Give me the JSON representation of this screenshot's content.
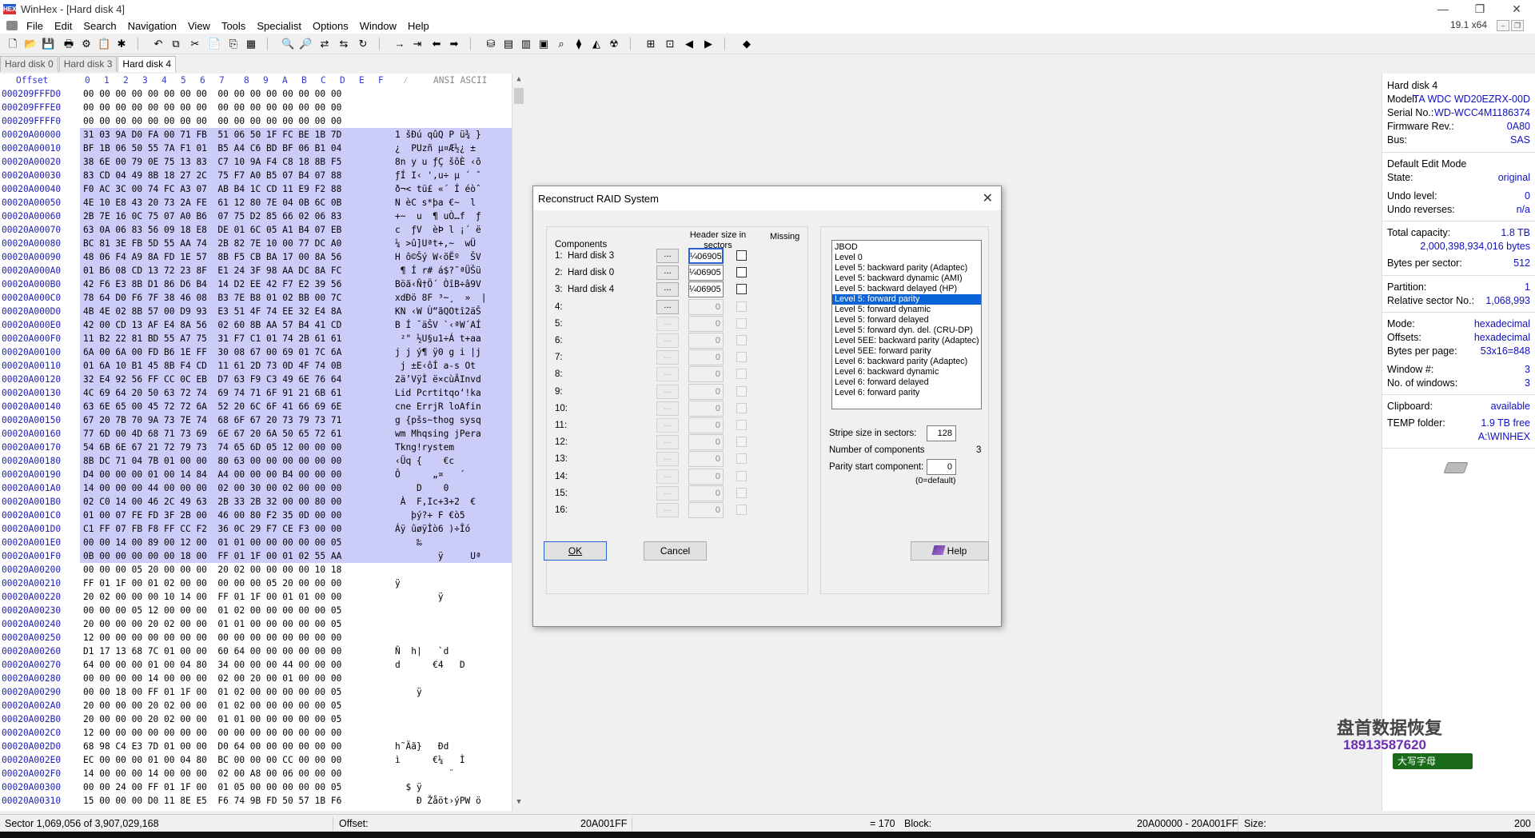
{
  "window": {
    "title": "WinHex - [Hard disk 4]",
    "icon_text": "HEX"
  },
  "menu": {
    "items": [
      "File",
      "Edit",
      "Search",
      "Navigation",
      "View",
      "Tools",
      "Specialist",
      "Options",
      "Window",
      "Help"
    ],
    "version": "19.1 x64"
  },
  "tabs": [
    "Hard disk 0",
    "Hard disk 3",
    "Hard disk 4"
  ],
  "hex": {
    "header_offset": "Offset",
    "header_cols": [
      "0",
      "1",
      "2",
      "3",
      "4",
      "5",
      "6",
      "7",
      "8",
      "9",
      "A",
      "B",
      "C",
      "D",
      "E",
      "F"
    ],
    "header_ascii": "ANSI ASCII",
    "rows": [
      {
        "off": "000209FFFD0",
        "b": "00 00 00 00 00 00 00 00  00 00 00 00 00 00 00 00",
        "a": ""
      },
      {
        "off": "000209FFFE0",
        "b": "00 00 00 00 00 00 00 00  00 00 00 00 00 00 00 00",
        "a": ""
      },
      {
        "off": "000209FFFF0",
        "b": "00 00 00 00 00 00 00 00  00 00 00 00 00 00 00 00",
        "a": ""
      },
      {
        "off": "00020A00000",
        "b": "31 03 9A D0 FA 00 71 FB  51 06 50 1F FC BE 1B 7D",
        "a": "1 šĐú qûQ P ü¾ }"
      },
      {
        "off": "00020A00010",
        "b": "BF 1B 06 50 55 7A F1 01  B5 A4 C6 BD BF 06 B1 04",
        "a": "¿  PUzñ µ¤Æ½¿ ±"
      },
      {
        "off": "00020A00020",
        "b": "38 6E 00 79 0E 75 13 83  C7 10 9A F4 C8 18 8B F5",
        "a": "8n y u ƒÇ šôÈ ‹õ"
      },
      {
        "off": "00020A00030",
        "b": "83 CD 04 49 8B 18 27 2C  75 F7 A0 B5 07 B4 07 88",
        "a": "ƒÍ I‹ ',u÷ µ ´ ˆ"
      },
      {
        "off": "00020A00040",
        "b": "F0 AC 3C 00 74 FC A3 07  AB B4 1C CD 11 E9 F2 88",
        "a": "ð¬< tü£ «´ Í éòˆ"
      },
      {
        "off": "00020A00050",
        "b": "4E 10 E8 43 20 73 2A FE  61 12 80 7E 04 0B 6C 0B",
        "a": "N èC s*þa €~  l"
      },
      {
        "off": "00020A00060",
        "b": "2B 7E 16 0C 75 07 A0 B6  07 75 D2 85 66 02 06 83",
        "a": "+~  u  ¶ uÒ…f  ƒ"
      },
      {
        "off": "00020A00070",
        "b": "63 0A 06 83 56 09 18 E8  DE 01 6C 05 A1 B4 07 EB",
        "a": "c  ƒV  èÞ l ¡´ ë"
      },
      {
        "off": "00020A00080",
        "b": "BC 81 3E FB 5D 55 AA 74  2B 82 7E 10 00 77 DC A0",
        "a": "¼ >û]Uªt+‚~  wÜ "
      },
      {
        "off": "00020A00090",
        "b": "48 06 F4 A9 8A FD 1E 57  8B F5 CB BA 17 00 8A 56",
        "a": "H ô©Šý W‹õËº  ŠV"
      },
      {
        "off": "00020A000A0",
        "b": "01 B6 08 CD 13 72 23 8F  E1 24 3F 98 AA DC 8A FC",
        "a": " ¶ Í r# á$?˜ªÜŠü"
      },
      {
        "off": "00020A000B0",
        "b": "42 F6 E3 8B D1 86 D6 B4  14 D2 EE 42 F7 E2 39 56",
        "a": "Böã‹Ñ†Ö´ ÒîB÷â9V"
      },
      {
        "off": "00020A000C0",
        "b": "78 64 D0 F6 7F 38 46 08  B3 7E B8 01 02 BB 00 7C",
        "a": "xdÐö 8F ³~¸  »  |"
      },
      {
        "off": "00020A000D0",
        "b": "4B 4E 02 8B 57 00 D9 93  E3 51 4F 74 EE 32 E4 8A",
        "a": "KN ‹W Ù“ãQOtî2äŠ"
      },
      {
        "off": "00020A000E0",
        "b": "42 00 CD 13 AF E4 8A 56  02 60 8B AA 57 B4 41 CD",
        "a": "B Í ¯äŠV `‹ªW´AÍ"
      },
      {
        "off": "00020A000F0",
        "b": "11 B2 22 81 BD 55 A7 75  31 F7 C1 01 74 2B 61 61",
        "a": " ²\" ½U§u1÷Á t+aa"
      },
      {
        "off": "00020A00100",
        "b": "6A 00 6A 00 FD B6 1E FF  30 08 67 00 69 01 7C 6A",
        "a": "j j ý¶ ÿ0 g i |j"
      },
      {
        "off": "00020A00110",
        "b": "01 6A 10 B1 45 8B F4 CD  11 61 2D 73 0D 4F 74 0B",
        "a": " j ±E‹ôÍ a-s Ot"
      },
      {
        "off": "00020A00120",
        "b": "32 E4 92 56 FF CC 0C EB  D7 63 F9 C3 49 6E 76 64",
        "a": "2ä’VÿÌ ë×cùÃInvd"
      },
      {
        "off": "00020A00130",
        "b": "4C 69 64 20 50 63 72 74  69 74 71 6F 91 21 6B 61",
        "a": "Lid Pcrtitqo‘!ka"
      },
      {
        "off": "00020A00140",
        "b": "63 6E 65 00 45 72 72 6A  52 20 6C 6F 41 66 69 6E",
        "a": "cne ErrjR loAfin"
      },
      {
        "off": "00020A00150",
        "b": "67 20 7B 70 9A 73 7E 74  68 6F 67 20 73 79 73 71",
        "a": "g {pšs~thog sysq"
      },
      {
        "off": "00020A00160",
        "b": "77 6D 00 4D 68 71 73 69  6E 67 20 6A 50 65 72 61",
        "a": "wm Mhqsing jPera"
      },
      {
        "off": "00020A00170",
        "b": "54 6B 6E 67 21 72 79 73  74 65 6D 05 12 00 00 00",
        "a": "Tkng!rystem"
      },
      {
        "off": "00020A00180",
        "b": "8B DC 71 04 7B 01 00 00  80 63 00 00 00 00 00 00",
        "a": "‹Üq {    €c"
      },
      {
        "off": "00020A00190",
        "b": "D4 00 00 00 01 00 14 84  A4 00 00 00 B4 00 00 00",
        "a": "Ô      „¤   ´"
      },
      {
        "off": "00020A001A0",
        "b": "14 00 00 00 44 00 00 00  02 00 30 00 02 00 00 00",
        "a": "    D    0"
      },
      {
        "off": "00020A001B0",
        "b": "02 C0 14 00 46 2C 49 63  2B 33 2B 32 00 00 80 00",
        "a": " À  F,Ic+3+2  €"
      },
      {
        "off": "00020A001C0",
        "b": "01 00 07 FE FD 3F 2B 00  46 00 80 F2 35 0D 00 00",
        "a": "   þý?+ F €ò5"
      },
      {
        "off": "00020A001D0",
        "b": "C1 FF 07 FB F8 FF CC F2  36 0C 29 F7 CE F3 00 00",
        "a": "Áÿ ûøÿÌò6 )÷Îó"
      },
      {
        "off": "00020A001E0",
        "b": "00 00 14 00 89 00 12 00  01 01 00 00 00 00 00 05",
        "a": "    ‰"
      },
      {
        "off": "00020A001F0",
        "b": "0B 00 00 00 00 00 18 00  FF 01 1F 00 01 02 55 AA",
        "a": "        ÿ     Uª"
      },
      {
        "off": "00020A00200",
        "b": "00 00 00 05 20 00 00 00  20 02 00 00 00 00 10 18",
        "a": ""
      },
      {
        "off": "00020A00210",
        "b": "FF 01 1F 00 01 02 00 00  00 00 00 05 20 00 00 00",
        "a": "ÿ"
      },
      {
        "off": "00020A00220",
        "b": "20 02 00 00 00 10 14 00  FF 01 1F 00 01 01 00 00",
        "a": "        ÿ"
      },
      {
        "off": "00020A00230",
        "b": "00 00 00 05 12 00 00 00  01 02 00 00 00 00 00 05",
        "a": ""
      },
      {
        "off": "00020A00240",
        "b": "20 00 00 00 20 02 00 00  01 01 00 00 00 00 00 05",
        "a": ""
      },
      {
        "off": "00020A00250",
        "b": "12 00 00 00 00 00 00 00  00 00 00 00 00 00 00 00",
        "a": ""
      },
      {
        "off": "00020A00260",
        "b": "D1 17 13 68 7C 01 00 00  60 64 00 00 00 00 00 00",
        "a": "Ñ  h|   `d"
      },
      {
        "off": "00020A00270",
        "b": "64 00 00 00 01 00 04 80  34 00 00 00 44 00 00 00",
        "a": "d      €4   D"
      },
      {
        "off": "00020A00280",
        "b": "00 00 00 00 14 00 00 00  02 00 20 00 01 00 00 00",
        "a": ""
      },
      {
        "off": "00020A00290",
        "b": "00 00 18 00 FF 01 1F 00  01 02 00 00 00 00 00 05",
        "a": "    ÿ"
      },
      {
        "off": "00020A002A0",
        "b": "20 00 00 00 20 02 00 00  01 02 00 00 00 00 00 05",
        "a": ""
      },
      {
        "off": "00020A002B0",
        "b": "20 00 00 00 20 02 00 00  01 01 00 00 00 00 00 05",
        "a": ""
      },
      {
        "off": "00020A002C0",
        "b": "12 00 00 00 00 00 00 00  00 00 00 00 00 00 00 00",
        "a": ""
      },
      {
        "off": "00020A002D0",
        "b": "68 98 C4 E3 7D 01 00 00  D0 64 00 00 00 00 00 00",
        "a": "h˜Äã}   Ðd"
      },
      {
        "off": "00020A002E0",
        "b": "EC 00 00 00 01 00 04 80  BC 00 00 00 CC 00 00 00",
        "a": "ì      €¼   Ì"
      },
      {
        "off": "00020A002F0",
        "b": "14 00 00 00 14 00 00 00  02 00 A8 00 06 00 00 00",
        "a": "          ¨"
      },
      {
        "off": "00020A00300",
        "b": "00 00 24 00 FF 01 1F 00  01 05 00 00 00 00 00 05",
        "a": "  $ ÿ"
      },
      {
        "off": "00020A00310",
        "b": "15 00 00 00 D0 11 8E E5  F6 74 9B FD 50 57 1B F6",
        "a": "    Ð Žåöt›ýPW ö"
      }
    ]
  },
  "info": {
    "disk_name": "Hard disk 4",
    "model_label": "Model:",
    "model": "TA WDC WD20EZRX-00D",
    "serial_label": "Serial No.:",
    "serial": "WD-WCC4M1186374",
    "fw_label": "Firmware Rev.:",
    "fw": "0A80",
    "bus_label": "Bus:",
    "bus": "SAS",
    "edit_mode_label": "Default Edit Mode",
    "state_label": "State:",
    "state": "original",
    "undo_level_label": "Undo level:",
    "undo_level": "0",
    "undo_rev_label": "Undo reverses:",
    "undo_rev": "n/a",
    "capacity_label": "Total capacity:",
    "capacity": "1.8 TB",
    "capacity_bytes": "2,000,398,934,016 bytes",
    "bps_label": "Bytes per sector:",
    "bps": "512",
    "partition_label": "Partition:",
    "partition": "1",
    "relsec_label": "Relative sector No.:",
    "relsec": "1,068,993",
    "mode_label": "Mode:",
    "mode": "hexadecimal",
    "offsets_label": "Offsets:",
    "offsets": "hexadecimal",
    "bpp_label": "Bytes per page:",
    "bpp": "53x16=848",
    "winnum_label": "Window #:",
    "winnum": "3",
    "nowin_label": "No. of windows:",
    "nowin": "3",
    "clip_label": "Clipboard:",
    "clip": "available",
    "temp_label": "TEMP folder:",
    "temp": "1.9 TB free",
    "temp_path": "A:\\WINHEX"
  },
  "status": {
    "sector": "Sector 1,069,056 of 3,907,029,168",
    "offset_label": "Offset:",
    "offset": "20A001FF",
    "value": "= 170",
    "block_label": "Block:",
    "block": "20A00000 - 20A001FF",
    "size_label": "Size:",
    "size": "200"
  },
  "dialog": {
    "title": "Reconstruct RAID System",
    "components_label": "Components",
    "header_size_label": "Header size in sectors",
    "missing_label": "Missing",
    "dots": "...",
    "components": [
      {
        "num": "1:",
        "name": "Hard disk 3",
        "hdr": "¼06905",
        "enabled": true
      },
      {
        "num": "2:",
        "name": "Hard disk 0",
        "hdr": "¼06905",
        "enabled": true
      },
      {
        "num": "3:",
        "name": "Hard disk 4",
        "hdr": "¼06905",
        "enabled": true
      },
      {
        "num": "4:",
        "name": "",
        "hdr": "0",
        "enabled": false,
        "dots_enabled": true
      },
      {
        "num": "5:",
        "name": "",
        "hdr": "0",
        "enabled": false
      },
      {
        "num": "6:",
        "name": "",
        "hdr": "0",
        "enabled": false
      },
      {
        "num": "7:",
        "name": "",
        "hdr": "0",
        "enabled": false
      },
      {
        "num": "8:",
        "name": "",
        "hdr": "0",
        "enabled": false
      },
      {
        "num": "9:",
        "name": "",
        "hdr": "0",
        "enabled": false
      },
      {
        "num": "10:",
        "name": "",
        "hdr": "0",
        "enabled": false
      },
      {
        "num": "11:",
        "name": "",
        "hdr": "0",
        "enabled": false
      },
      {
        "num": "12:",
        "name": "",
        "hdr": "0",
        "enabled": false
      },
      {
        "num": "13:",
        "name": "",
        "hdr": "0",
        "enabled": false
      },
      {
        "num": "14:",
        "name": "",
        "hdr": "0",
        "enabled": false
      },
      {
        "num": "15:",
        "name": "",
        "hdr": "0",
        "enabled": false
      },
      {
        "num": "16:",
        "name": "",
        "hdr": "0",
        "enabled": false
      }
    ],
    "levels": [
      "JBOD",
      "Level 0",
      "Level 5: backward parity (Adaptec)",
      "Level 5: backward dynamic (AMI)",
      "Level 5: backward delayed (HP)",
      "Level 5: forward parity",
      "Level 5: forward dynamic",
      "Level 5: forward delayed",
      "Level 5: forward dyn. del. (CRU-DP)",
      "Level 5EE: backward parity (Adaptec)",
      "Level 5EE: forward parity",
      "Level 6: backward parity (Adaptec)",
      "Level 6: backward dynamic",
      "Level 6: forward delayed",
      "Level 6: forward parity"
    ],
    "selected_level": "Level 5: forward parity",
    "stripe_label": "Stripe size in sectors:",
    "stripe": "128",
    "numcomp_label": "Number of components",
    "numcomp": "3",
    "parity_label": "Parity start component:",
    "parity": "0",
    "parity_hint": "(0=default)",
    "ok": "OK",
    "cancel": "Cancel",
    "help": "Help"
  },
  "watermark": {
    "line1": "盘首数据恢复",
    "line2": "18913587620",
    "ime": "大写字母"
  }
}
